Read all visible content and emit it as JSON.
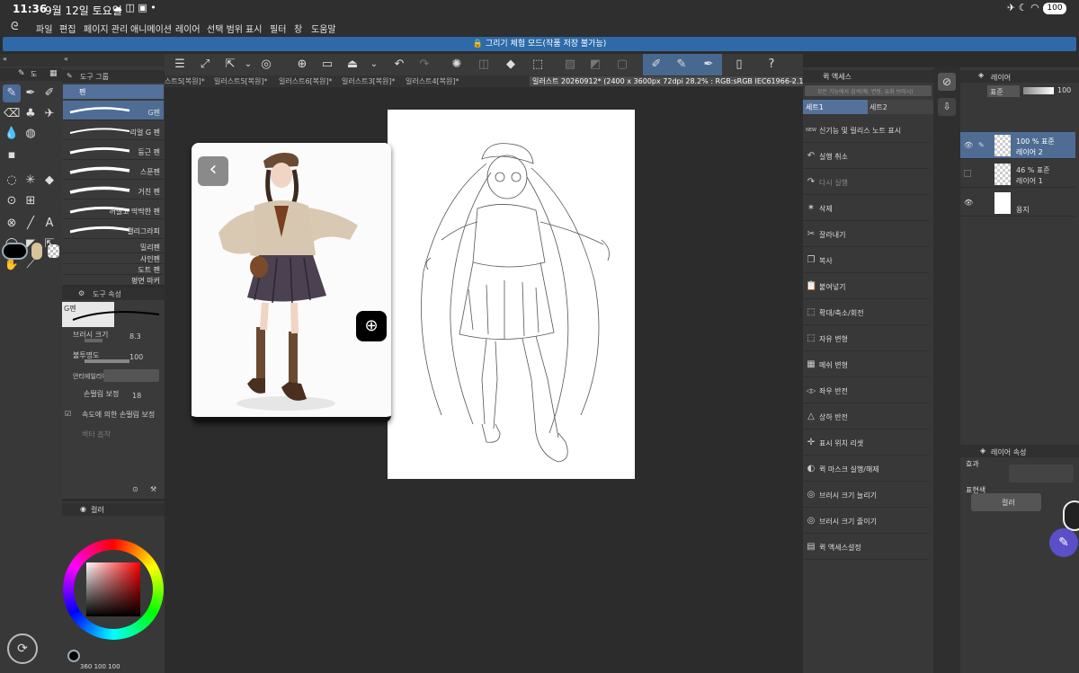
{
  "status": {
    "time": "11:36",
    "date": "9월 12일 토요일",
    "battery": "100"
  },
  "menu": [
    "파일",
    "편집",
    "페이지 관리",
    "애니메이션",
    "레이어",
    "선택 범위",
    "표시",
    "필터",
    "창",
    "도움말"
  ],
  "banner": "그리기 체험 모드(작품 저장 불가능)",
  "tabs": {
    "items": [
      "스트5[복원]*",
      "일러스트5[복원]*",
      "일러스트6[복원]*",
      "일러스트3[복원]*",
      "일러스트4[복원]*"
    ],
    "active": "일러스트 20260912* (2400 x 3600px 72dpi 28.2% : RGB:sRGB IEC61966-2.1)"
  },
  "subtool": {
    "header_tab": "도",
    "group_title": "도구 그룹",
    "current_group": "펜",
    "selected_brush": "G펜",
    "brushes": [
      "리얼 G 펜",
      "둥근 펜",
      "스푼펜",
      "거친 펜",
      "꺼칠고 딱딱한 펜",
      "캘리그라피",
      "밀리펜",
      "사인펜",
      "도트 펜",
      "평면 마커"
    ]
  },
  "toolprop": {
    "title": "도구 속성",
    "preview_label": "G펜",
    "brush_size_label": "브러시 크기",
    "brush_size_value": "8.3",
    "opacity_label": "불투명도",
    "opacity_value": "100",
    "antialias_label": "안티에일리어싱",
    "stabilization_label": "손떨림 보정",
    "stabilization_value": "18",
    "speed_stab_label": "속도에 의한 손떨림 보정",
    "vector_label": "벡터 흡착"
  },
  "color": {
    "tab_label": "컬러",
    "footer": "360 100 100"
  },
  "quick": {
    "title": "퀵 액세스",
    "search_placeholder": "모든 기능에서 검색(예: 변형, 유화 브러시)",
    "set1": "세트1",
    "set2": "세트2",
    "items": [
      {
        "icon": "NEW",
        "label": "신기능 및 릴리스 노트 표시"
      },
      {
        "icon": "↶",
        "label": "실행 취소"
      },
      {
        "icon": "↷",
        "label": "다시 실행"
      },
      {
        "icon": "✶",
        "label": "삭제"
      },
      {
        "icon": "✂",
        "label": "잘라내기"
      },
      {
        "icon": "❐",
        "label": "복사"
      },
      {
        "icon": "📋",
        "label": "붙여넣기"
      },
      {
        "icon": "⬚",
        "label": "확대/축소/회전"
      },
      {
        "icon": "⬚",
        "label": "자유 변형"
      },
      {
        "icon": "▦",
        "label": "메쉬 변형"
      },
      {
        "icon": "◁▷",
        "label": "좌우 반전"
      },
      {
        "icon": "△",
        "label": "상하 반전"
      },
      {
        "icon": "✛",
        "label": "표시 위치 리셋"
      },
      {
        "icon": "◐",
        "label": "퀵 마스크 실행/해제"
      },
      {
        "icon": "◎",
        "label": "브러시 크기 늘리기"
      },
      {
        "icon": "◎",
        "label": "브러시 크기 줄이기"
      },
      {
        "icon": "▤",
        "label": "퀵 액세스설정"
      }
    ]
  },
  "layers": {
    "title": "레이어",
    "blend": "표준",
    "opacity": "100",
    "items": [
      {
        "mode": "100 % 표준",
        "name": "레이어 2",
        "visible": true
      },
      {
        "mode": "46 % 표준",
        "name": "레이어 1",
        "visible": false
      },
      {
        "mode": "",
        "name": "용지",
        "visible": true
      }
    ]
  },
  "layerprop": {
    "title": "레이어 속성",
    "effect": "효과",
    "express": "표현색",
    "express_value": "컬러"
  }
}
